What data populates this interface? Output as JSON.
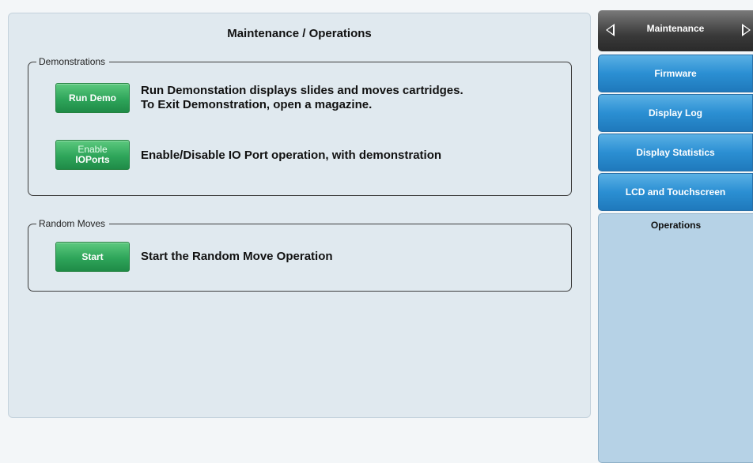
{
  "main": {
    "title": "Maintenance / Operations",
    "demonstrations": {
      "legend": "Demonstrations",
      "run_demo_label": "Run Demo",
      "run_demo_desc_1": "Run Demonstation displays slides and moves cartridges.",
      "run_demo_desc_2": "To Exit Demonstration, open a magazine.",
      "enable_io_label_1": "Enable",
      "enable_io_label_2": "IOPorts",
      "enable_io_desc": "Enable/Disable IO Port operation, with demonstration"
    },
    "random_moves": {
      "legend": "Random Moves",
      "start_label": "Start",
      "start_desc": "Start the Random Move Operation"
    }
  },
  "sidebar": {
    "header": "Maintenance",
    "items": [
      {
        "label": "Firmware"
      },
      {
        "label": "Display Log"
      },
      {
        "label": "Display Statistics"
      },
      {
        "label": "LCD and Touchscreen"
      }
    ],
    "active": "Operations"
  },
  "colors": {
    "panel_bg": "#e0e9ef",
    "green_button": "#2ea55a",
    "blue_button": "#2b8fd3",
    "header_dark": "#3a3a3a",
    "active_tab": "#b6d2e6"
  }
}
